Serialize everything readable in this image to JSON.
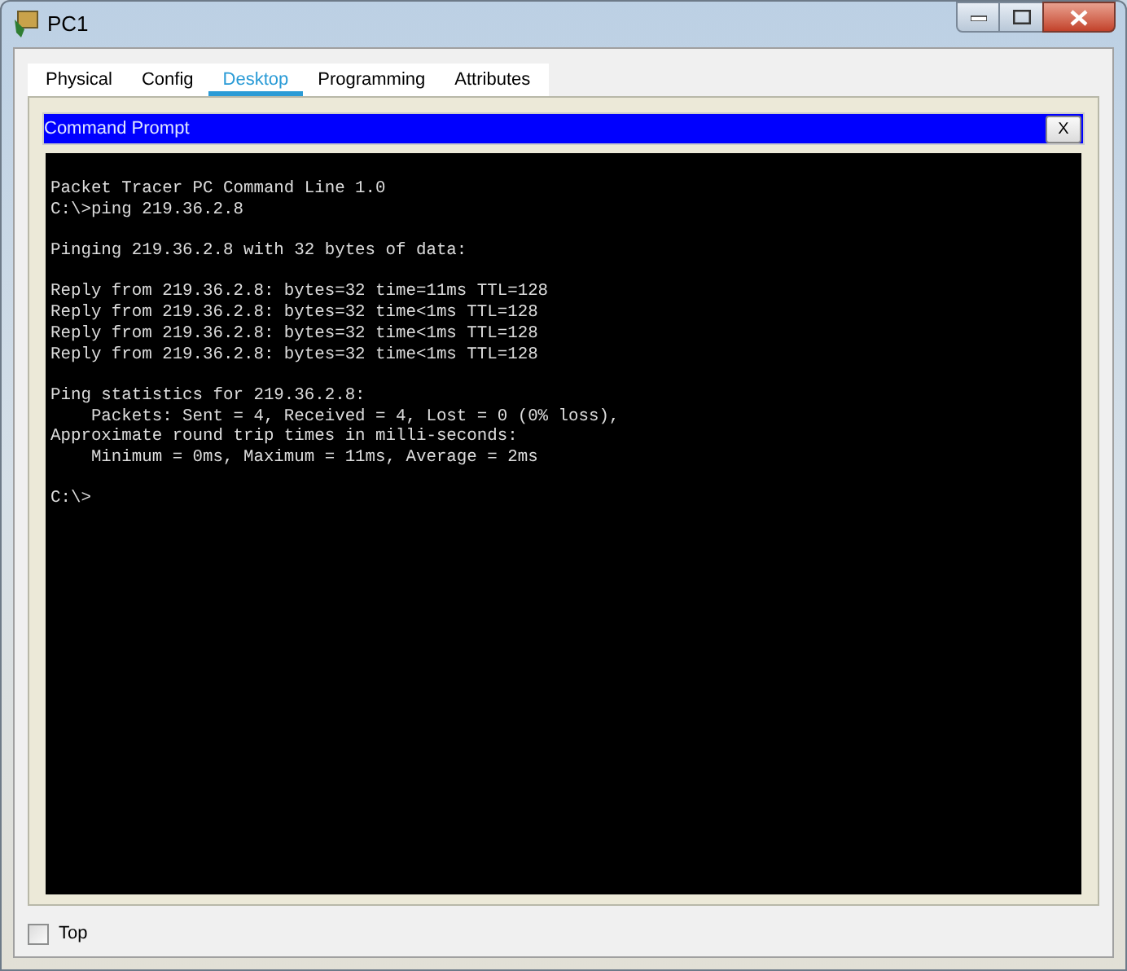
{
  "window": {
    "title": "PC1"
  },
  "tabs": [
    {
      "label": "Physical",
      "selected": false
    },
    {
      "label": "Config",
      "selected": false
    },
    {
      "label": "Desktop",
      "selected": true
    },
    {
      "label": "Programming",
      "selected": false
    },
    {
      "label": "Attributes",
      "selected": false
    }
  ],
  "command_prompt": {
    "title": "Command Prompt",
    "close_label": "X",
    "blocks": [
      [
        "Packet Tracer PC Command Line 1.0",
        "C:\\>ping 219.36.2.8"
      ],
      [
        "Pinging 219.36.2.8 with 32 bytes of data:"
      ],
      [
        "Reply from 219.36.2.8: bytes=32 time=11ms TTL=128",
        "Reply from 219.36.2.8: bytes=32 time<1ms TTL=128",
        "Reply from 219.36.2.8: bytes=32 time<1ms TTL=128",
        "Reply from 219.36.2.8: bytes=32 time<1ms TTL=128"
      ],
      [
        "Ping statistics for 219.36.2.8:",
        "    Packets: Sent = 4, Received = 4, Lost = 0 (0% loss),",
        "Approximate round trip times in milli-seconds:",
        "    Minimum = 0ms, Maximum = 11ms, Average = 2ms"
      ],
      [
        "C:\\>"
      ]
    ]
  },
  "top_checkbox": {
    "label": "Top",
    "checked": false
  }
}
